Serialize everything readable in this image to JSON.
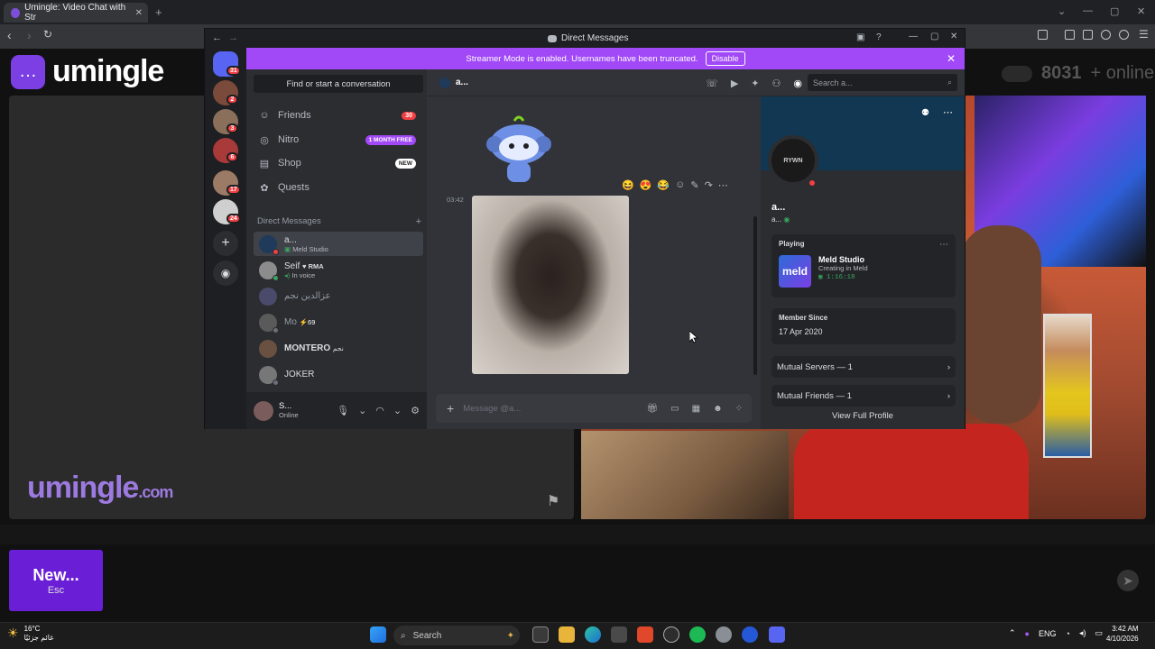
{
  "browser": {
    "tab_title": "Umingle: Video Chat with Str",
    "tab_close": "✕",
    "new_tab": "+"
  },
  "umingle": {
    "logo_text": "umingle",
    "online_count": "8031",
    "online_label": "+ online",
    "watermark": "umingle",
    "watermark_suffix": ".com",
    "new_button": "New...",
    "new_shortcut": "Esc"
  },
  "discord": {
    "window_title": "Direct Messages",
    "streamer_banner": "Streamer Mode is enabled. Usernames have been truncated.",
    "disable_button": "Disable",
    "servers": [
      {
        "badge": "31"
      },
      {
        "badge": "2"
      },
      {
        "badge": "3"
      },
      {
        "badge": "6"
      },
      {
        "badge": "17"
      },
      {
        "badge": "24"
      }
    ],
    "find_placeholder": "Find or start a conversation",
    "nav": [
      {
        "label": "Friends",
        "badge": "30"
      },
      {
        "label": "Nitro",
        "badge": "1 MONTH FREE"
      },
      {
        "label": "Shop",
        "badge": "NEW"
      },
      {
        "label": "Quests",
        "badge": ""
      }
    ],
    "dm_header": "Direct Messages",
    "dm_add": "+",
    "dms": [
      {
        "name": "a...",
        "sub": "Meld Studio"
      },
      {
        "name": "Seif",
        "tag": "RMA",
        "sub": "In voice"
      },
      {
        "name": "عزالدين نجم",
        "sub": ""
      },
      {
        "name": "Mo",
        "tag": "69",
        "sub": ""
      },
      {
        "name": "MONTERO",
        "tag": "نجم",
        "sub": ""
      },
      {
        "name": "JOKER",
        "sub": ""
      }
    ],
    "user": {
      "name": "S...",
      "status": "Online"
    },
    "chat": {
      "channel": "a...",
      "search_placeholder": "Search a...",
      "message_time": "03:42",
      "composer_placeholder": "Message @a..."
    },
    "profile": {
      "name": "a...",
      "tag": "a...",
      "avatar_text": "RYWN",
      "playing_label": "Playing",
      "game": "Meld Studio",
      "game_state": "Creating in Meld",
      "game_time": "1:16:18",
      "meld_logo": "meld",
      "member_since_label": "Member Since",
      "member_since": "17 Apr 2020",
      "mutual_servers": "Mutual Servers — 1",
      "mutual_friends": "Mutual Friends — 1",
      "view_full": "View Full Profile"
    }
  },
  "taskbar": {
    "temperature": "16°C",
    "weather_text": "غائم جزئيًا",
    "search_label": "Search",
    "lang": "ENG",
    "time": "3:42 AM",
    "date": "4/10/2026"
  },
  "colors": {
    "discord_purple": "#a148f7",
    "umingle_purple": "#6a1fd6",
    "discord_red": "#f23f42"
  }
}
